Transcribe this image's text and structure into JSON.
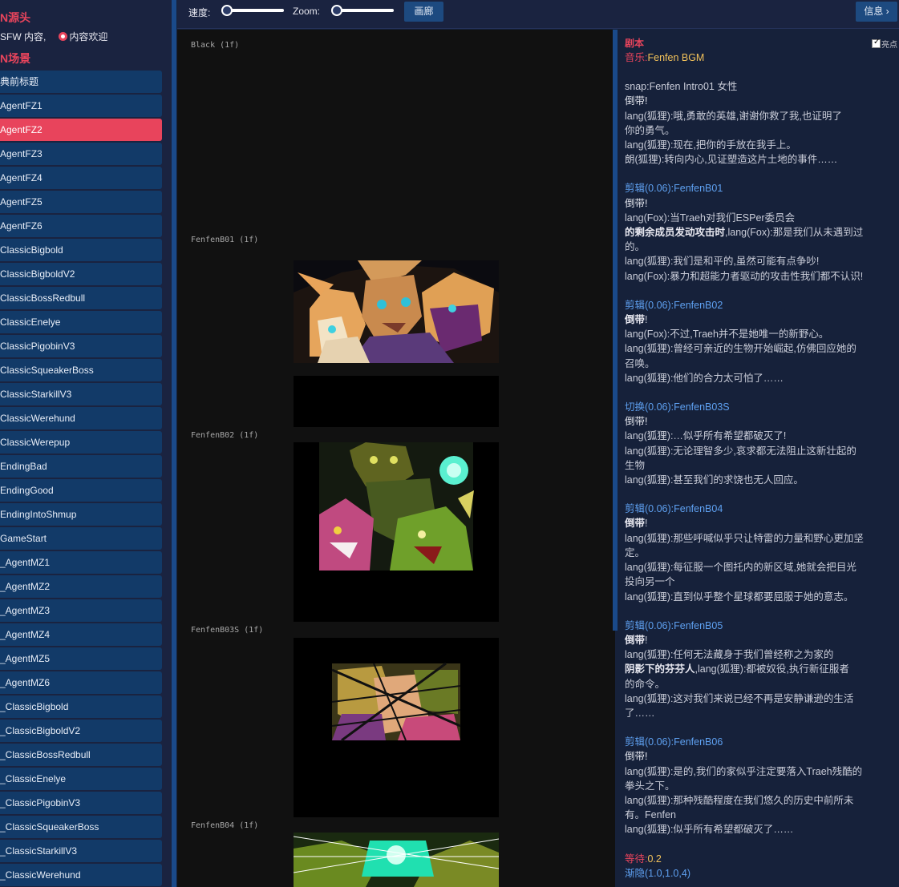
{
  "sidebar": {
    "source_heading": "N源头",
    "filter_sfw": "SFW 内容,",
    "filter_welcome": "内容欢迎",
    "scenes_heading": "N场景",
    "scenes": [
      {
        "label": "典前标题",
        "active": false
      },
      {
        "label": "AgentFZ1",
        "active": false
      },
      {
        "label": "AgentFZ2",
        "active": true
      },
      {
        "label": "AgentFZ3",
        "active": false
      },
      {
        "label": "AgentFZ4",
        "active": false
      },
      {
        "label": "AgentFZ5",
        "active": false
      },
      {
        "label": "AgentFZ6",
        "active": false
      },
      {
        "label": "ClassicBigbold",
        "active": false
      },
      {
        "label": "ClassicBigboldV2",
        "active": false
      },
      {
        "label": "ClassicBossRedbull",
        "active": false
      },
      {
        "label": "ClassicEnelye",
        "active": false
      },
      {
        "label": "ClassicPigobinV3",
        "active": false
      },
      {
        "label": "ClassicSqueakerBoss",
        "active": false
      },
      {
        "label": "ClassicStarkillV3",
        "active": false
      },
      {
        "label": "ClassicWerehund",
        "active": false
      },
      {
        "label": "ClassicWerepup",
        "active": false
      },
      {
        "label": "EndingBad",
        "active": false
      },
      {
        "label": "EndingGood",
        "active": false
      },
      {
        "label": "EndingIntoShmup",
        "active": false
      },
      {
        "label": "GameStart",
        "active": false
      },
      {
        "label": "_AgentMZ1",
        "active": false
      },
      {
        "label": "_AgentMZ2",
        "active": false
      },
      {
        "label": "_AgentMZ3",
        "active": false
      },
      {
        "label": "_AgentMZ4",
        "active": false
      },
      {
        "label": "_AgentMZ5",
        "active": false
      },
      {
        "label": "_AgentMZ6",
        "active": false
      },
      {
        "label": "_ClassicBigbold",
        "active": false
      },
      {
        "label": "_ClassicBigboldV2",
        "active": false
      },
      {
        "label": "_ClassicBossRedbull",
        "active": false
      },
      {
        "label": "_ClassicEnelye",
        "active": false
      },
      {
        "label": "_ClassicPigobinV3",
        "active": false
      },
      {
        "label": "_ClassicSqueakerBoss",
        "active": false
      },
      {
        "label": "_ClassicStarkillV3",
        "active": false
      },
      {
        "label": "_ClassicWerehund",
        "active": false
      }
    ]
  },
  "toolbar": {
    "speed_label": "速度:",
    "zoom_label": "Zoom:",
    "gallery_button": "画廊",
    "info_button": "信息 ›"
  },
  "frames": [
    {
      "label": "Black (1f)"
    },
    {
      "label": "FenfenB01 (1f)"
    },
    {
      "label": "FenfenB02 (1f)"
    },
    {
      "label": "FenfenB03S (1f)"
    },
    {
      "label": "FenfenB04 (1f)"
    }
  ],
  "script": {
    "title": "剧本",
    "highlight_label": "亮点",
    "lines": [
      [
        {
          "c": "pink",
          "t": "音乐:"
        },
        {
          "c": "gold",
          "t": "Fenfen BGM"
        }
      ],
      [],
      [
        {
          "c": "",
          "t": "snap:Fenfen Intro01 女性"
        }
      ],
      [
        {
          "c": "bright",
          "t": "倒带!"
        }
      ],
      [
        {
          "c": "",
          "t": "lang(狐狸):哦,勇敢的英雄,谢谢你救了我,也证明了"
        }
      ],
      [
        {
          "c": "",
          "t": "你的勇气。"
        }
      ],
      [
        {
          "c": "",
          "t": "lang(狐狸):现在,把你的手放在我手上。"
        }
      ],
      [
        {
          "c": "",
          "t": "朗(狐狸):转向内心,见证塑造这片土地的事件……"
        }
      ],
      [],
      [
        {
          "c": "blue",
          "t": "剪辑(0.06):FenfenB01"
        }
      ],
      [
        {
          "c": "bright",
          "t": "倒带!"
        }
      ],
      [
        {
          "c": "",
          "t": "lang(Fox):当Traeh对我们ESPer委员会"
        }
      ],
      [
        {
          "c": "bold",
          "t": "的剩余成员发动攻击时"
        },
        {
          "c": "",
          "t": ",lang(Fox):那是我们从未遇到过"
        }
      ],
      [
        {
          "c": "",
          "t": "的。"
        }
      ],
      [
        {
          "c": "",
          "t": "lang(狐狸):我们是和平的,虽然可能有点争吵!"
        }
      ],
      [
        {
          "c": "",
          "t": "lang(Fox):暴力和超能力者驱动的攻击性我们都不认识!"
        }
      ],
      [],
      [
        {
          "c": "blue",
          "t": "剪辑(0.06):FenfenB02"
        }
      ],
      [
        {
          "c": "bold",
          "t": "倒带"
        },
        {
          "c": "",
          "t": "!"
        }
      ],
      [
        {
          "c": "",
          "t": "lang(Fox):不过,Traeh并不是她唯一的新野心。"
        }
      ],
      [
        {
          "c": "",
          "t": "lang(狐狸):曾经可亲近的生物开始崛起,仿佛回应她的"
        }
      ],
      [
        {
          "c": "",
          "t": "召唤。"
        }
      ],
      [
        {
          "c": "",
          "t": "lang(狐狸):他们的合力太可怕了……"
        }
      ],
      [],
      [
        {
          "c": "blue",
          "t": "切换(0.06):FenfenB03S"
        }
      ],
      [
        {
          "c": "bright",
          "t": "倒带!"
        }
      ],
      [
        {
          "c": "",
          "t": "lang(狐狸):…似乎所有希望都破灭了!"
        }
      ],
      [
        {
          "c": "",
          "t": "lang(狐狸):无论理智多少,哀求都无法阻止这新壮起的"
        }
      ],
      [
        {
          "c": "",
          "t": "生物"
        }
      ],
      [
        {
          "c": "",
          "t": "lang(狐狸):甚至我们的求饶也无人回应。"
        }
      ],
      [],
      [
        {
          "c": "blue",
          "t": "剪辑(0.06):FenfenB04"
        }
      ],
      [
        {
          "c": "bold",
          "t": "倒带"
        },
        {
          "c": "",
          "t": "!"
        }
      ],
      [
        {
          "c": "",
          "t": "lang(狐狸):那些呼喊似乎只让特雷的力量和野心更加坚"
        }
      ],
      [
        {
          "c": "",
          "t": "定。"
        }
      ],
      [
        {
          "c": "",
          "t": "lang(狐狸):每征服一个图托内的新区域,她就会把目光"
        }
      ],
      [
        {
          "c": "",
          "t": "投向另一个"
        }
      ],
      [
        {
          "c": "",
          "t": "lang(狐狸):直到似乎整个星球都要屈服于她的意志。"
        }
      ],
      [],
      [
        {
          "c": "blue",
          "t": "剪辑(0.06):FenfenB05"
        }
      ],
      [
        {
          "c": "bold",
          "t": "倒带"
        },
        {
          "c": "",
          "t": "!"
        }
      ],
      [
        {
          "c": "",
          "t": "lang(狐狸):任何无法藏身于我们曾经称之为家的"
        }
      ],
      [
        {
          "c": "bold",
          "t": "阴影下的芬芬人"
        },
        {
          "c": "",
          "t": ",lang(狐狸):都被奴役,执行新征服者"
        }
      ],
      [
        {
          "c": "",
          "t": "的命令。"
        }
      ],
      [
        {
          "c": "",
          "t": "lang(狐狸):这对我们来说已经不再是安静谦逊的生活"
        }
      ],
      [
        {
          "c": "",
          "t": "了……"
        }
      ],
      [],
      [
        {
          "c": "blue",
          "t": "剪辑(0.06):FenfenB06"
        }
      ],
      [
        {
          "c": "bright",
          "t": "倒带!"
        }
      ],
      [
        {
          "c": "",
          "t": "lang(狐狸):是的,我们的家似乎注定要落入Traeh残酷的"
        }
      ],
      [
        {
          "c": "",
          "t": "拳头之下。"
        }
      ],
      [
        {
          "c": "",
          "t": "lang(狐狸):那种残酷程度在我们悠久的历史中前所未"
        }
      ],
      [
        {
          "c": "",
          "t": "有。Fenfen"
        }
      ],
      [
        {
          "c": "",
          "t": "lang(狐狸):似乎所有希望都破灭了……"
        }
      ],
      [],
      [
        {
          "c": "pink",
          "t": "等待:"
        },
        {
          "c": "gold",
          "t": "0.2"
        }
      ],
      [
        {
          "c": "blue",
          "t": "渐隐(1.0,1.0,4)"
        }
      ]
    ]
  }
}
